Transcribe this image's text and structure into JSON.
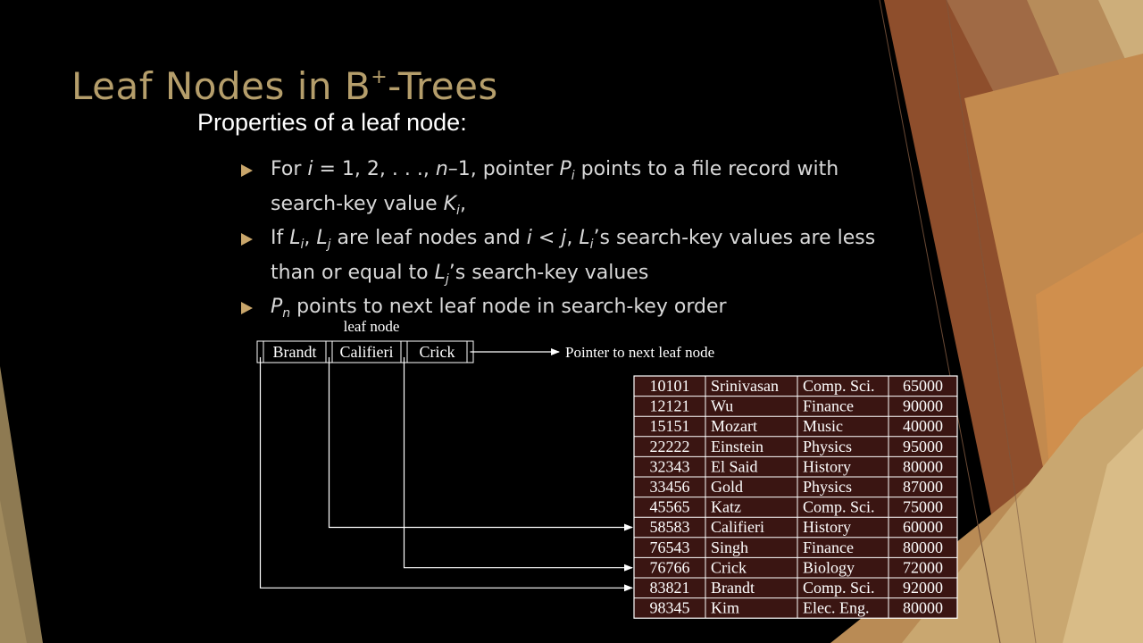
{
  "slide": {
    "title_main": "Leaf Nodes in B",
    "title_sup": "+",
    "title_tail": "-Trees",
    "subtitle": "Properties of a leaf node:"
  },
  "bullets": [
    {
      "lines": [
        [
          {
            "t": "For "
          },
          {
            "t": "i",
            "i": 1
          },
          {
            "t": " = 1, 2, . . ., "
          },
          {
            "t": "n",
            "i": 1
          },
          {
            "t": "–1, pointer "
          },
          {
            "t": "P",
            "i": 1
          },
          {
            "t": "i",
            "sub": 1,
            "i": 1
          },
          {
            "t": " points to a file record with"
          }
        ],
        [
          {
            "t": "search-key value "
          },
          {
            "t": "K",
            "i": 1
          },
          {
            "t": "i",
            "sub": 1,
            "i": 1
          },
          {
            "t": ","
          }
        ]
      ]
    },
    {
      "lines": [
        [
          {
            "t": "If "
          },
          {
            "t": "L",
            "i": 1
          },
          {
            "t": "i",
            "sub": 1,
            "i": 1
          },
          {
            "t": ", "
          },
          {
            "t": "L",
            "i": 1
          },
          {
            "t": "j",
            "sub": 1,
            "i": 1
          },
          {
            "t": " are leaf nodes and "
          },
          {
            "t": "i",
            "i": 1
          },
          {
            "t": " < "
          },
          {
            "t": "j",
            "i": 1
          },
          {
            "t": ", "
          },
          {
            "t": "L",
            "i": 1
          },
          {
            "t": "i",
            "sub": 1,
            "i": 1
          },
          {
            "t": "’s search-key values are less"
          }
        ],
        [
          {
            "t": "than or equal to "
          },
          {
            "t": "L",
            "i": 1
          },
          {
            "t": "j",
            "sub": 1,
            "i": 1
          },
          {
            "t": "’s search-key values"
          }
        ]
      ]
    },
    {
      "lines": [
        [
          {
            "t": "P",
            "i": 1
          },
          {
            "t": "n",
            "sub": 1,
            "i": 1
          },
          {
            "t": " points to next leaf node in search-key order"
          }
        ]
      ]
    }
  ],
  "diagram": {
    "leaf_label": "leaf node",
    "leaf_keys": [
      "Brandt",
      "Califieri",
      "Crick"
    ],
    "next_pointer_label": "Pointer to next leaf node",
    "records": [
      [
        "10101",
        "Srinivasan",
        "Comp. Sci.",
        "65000"
      ],
      [
        "12121",
        "Wu",
        "Finance",
        "90000"
      ],
      [
        "15151",
        "Mozart",
        "Music",
        "40000"
      ],
      [
        "22222",
        "Einstein",
        "Physics",
        "95000"
      ],
      [
        "32343",
        "El Said",
        "History",
        "80000"
      ],
      [
        "33456",
        "Gold",
        "Physics",
        "87000"
      ],
      [
        "45565",
        "Katz",
        "Comp. Sci.",
        "75000"
      ],
      [
        "58583",
        "Califieri",
        "History",
        "60000"
      ],
      [
        "76543",
        "Singh",
        "Finance",
        "80000"
      ],
      [
        "76766",
        "Crick",
        "Biology",
        "72000"
      ],
      [
        "83821",
        "Brandt",
        "Comp. Sci.",
        "92000"
      ],
      [
        "98345",
        "Kim",
        "Elec. Eng.",
        "80000"
      ]
    ],
    "pointer_targets": [
      {
        "key_index": 0,
        "record_index": 10
      },
      {
        "key_index": 1,
        "record_index": 7
      },
      {
        "key_index": 2,
        "record_index": 9
      }
    ]
  },
  "colors": {
    "title": "#B59E6B",
    "table_fill": "#3A1512",
    "accent_gold": "#C9A66B"
  }
}
